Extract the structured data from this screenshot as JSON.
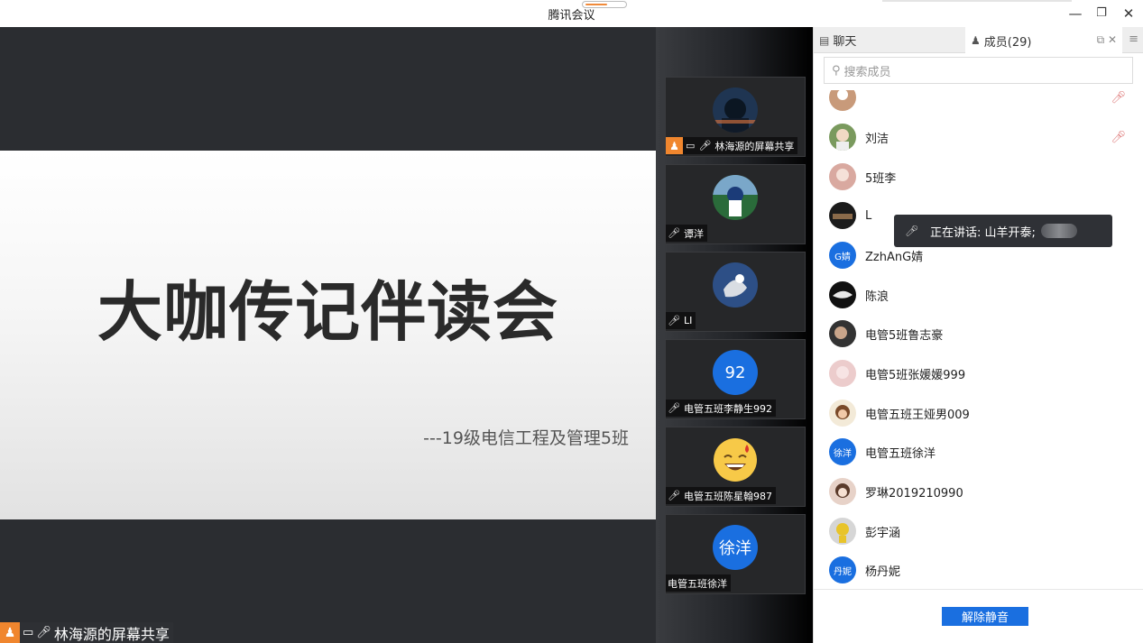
{
  "window": {
    "title": "腾讯会议",
    "minimize": "—",
    "restore": "❐",
    "close": "✕"
  },
  "share": {
    "slide_title": "大咖传记伴读会",
    "slide_subtitle": "---19级电信工程及管理5班",
    "label": "林海源的屏幕共享"
  },
  "video_tiles": [
    {
      "name": "林海源的屏幕共享",
      "avatar": "photo",
      "state": "sharing"
    },
    {
      "name": "谭洋",
      "avatar": "photo",
      "state": "muted"
    },
    {
      "name": "LI",
      "avatar": "photo",
      "state": "muted"
    },
    {
      "name": "电管五班李静生992",
      "avatar_text": "92",
      "state": "muted"
    },
    {
      "name": "电管五班陈星翰987",
      "avatar": "emoji",
      "emoji": "😅",
      "state": "muted"
    },
    {
      "name": "电管五班徐洋",
      "avatar_text": "徐洋",
      "state": "none"
    }
  ],
  "panel": {
    "tab_chat": "聊天",
    "tab_members": "成员(29)",
    "search_placeholder": "搜索成员",
    "members": [
      {
        "name": "",
        "avatar": "photo"
      },
      {
        "name": "刘洁",
        "avatar": "photo"
      },
      {
        "name": "5班李",
        "avatar": "photo"
      },
      {
        "name": "L",
        "avatar": "photo"
      },
      {
        "name": "ZzhAnG婧",
        "avatar_text": "G婧"
      },
      {
        "name": "陈浪",
        "avatar": "photo"
      },
      {
        "name": "电管5班鲁志豪",
        "avatar": "photo"
      },
      {
        "name": "电管5班张媛媛999",
        "avatar": "photo"
      },
      {
        "name": "电管五班王娅男009",
        "avatar": "photo"
      },
      {
        "name": "电管五班徐洋",
        "avatar_text": "徐洋"
      },
      {
        "name": "罗琳2019210990",
        "avatar": "photo"
      },
      {
        "name": "彭宇涵",
        "avatar": "photo"
      },
      {
        "name": "杨丹妮",
        "avatar_text": "丹妮"
      }
    ],
    "speaking_tooltip": "正在讲话: 山羊开泰;",
    "unmute_button": "解除静音"
  },
  "colors": {
    "accent": "#1a6fe0",
    "share_orange": "#f0862e",
    "dark_bg": "#2b2d31"
  }
}
